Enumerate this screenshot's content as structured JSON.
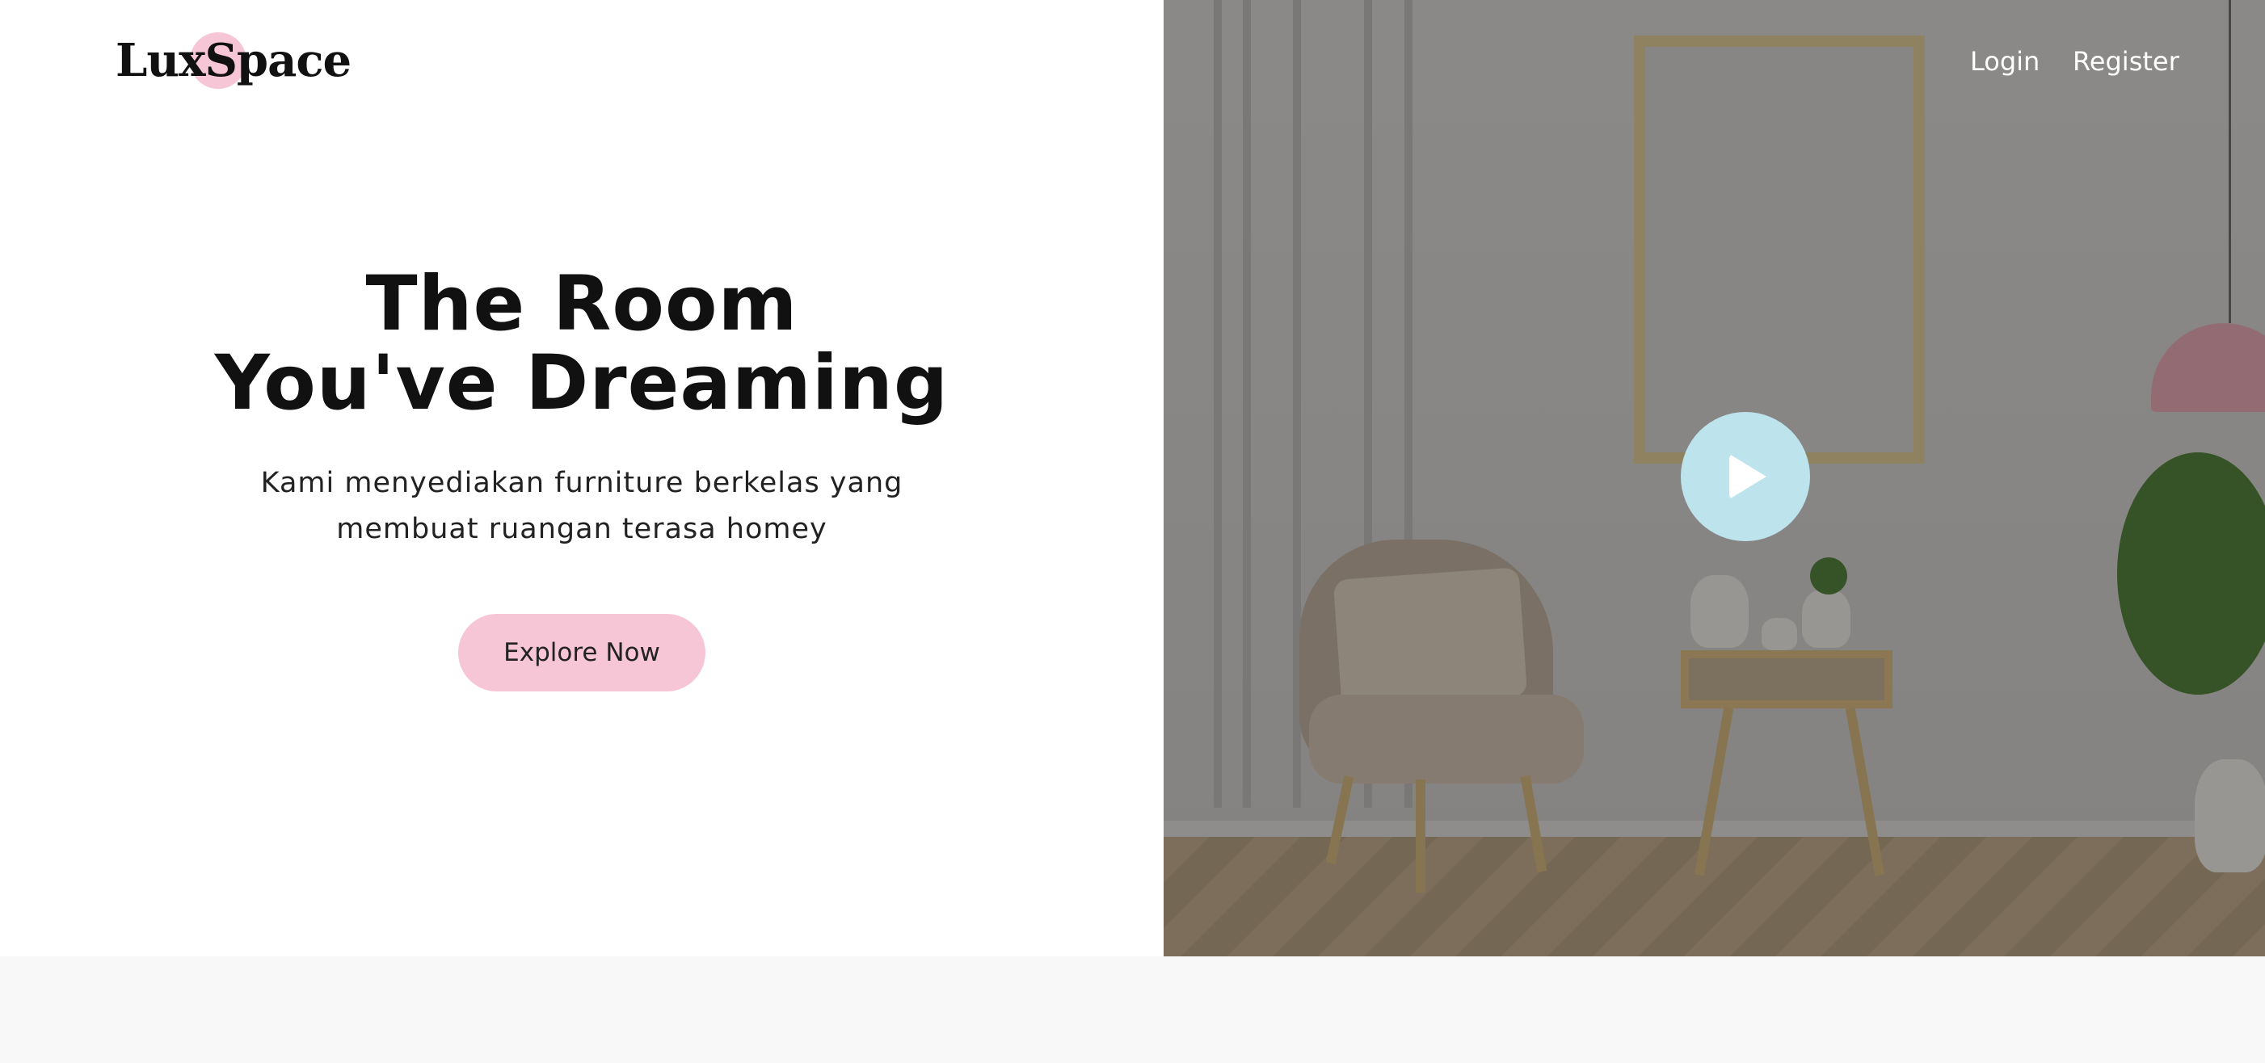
{
  "brand": {
    "logo_text": "LuxSpace"
  },
  "nav": {
    "login_label": "Login",
    "register_label": "Register"
  },
  "hero": {
    "title_line1": "The Room",
    "title_line2": "You've Dreaming",
    "subtitle_line1": "Kami menyediakan furniture berkelas yang",
    "subtitle_line2": "membuat ruangan terasa homey",
    "cta_label": "Explore Now"
  },
  "colors": {
    "accent_pink": "#f7c6d6",
    "play_button": "#bde3ed",
    "background": "#ffffff",
    "footer_band": "#f8f8f8"
  },
  "icons": {
    "play": "play-icon"
  }
}
